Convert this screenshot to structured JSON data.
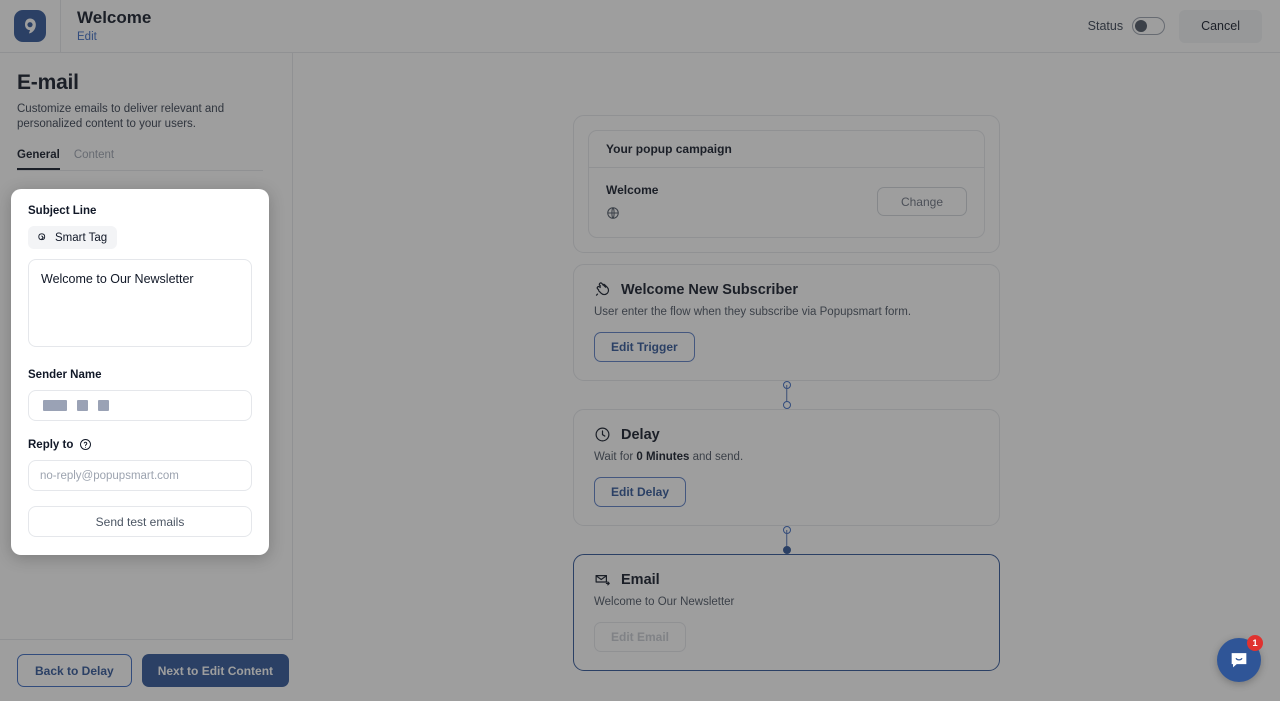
{
  "topbar": {
    "logo_icon": "popupsmart-logo-icon",
    "title": "Welcome",
    "edit_link": "Edit",
    "status_label": "Status",
    "status_on": false,
    "cancel_label": "Cancel"
  },
  "left_panel": {
    "heading": "E-mail",
    "description": "Customize emails to deliver relevant and personalized content to your users.",
    "tabs": [
      {
        "label": "General",
        "active": true
      },
      {
        "label": "Content",
        "active": false
      }
    ],
    "form": {
      "subject_label": "Subject Line",
      "smart_tag_label": "Smart Tag",
      "smart_tag_icon": "code-braces-icon",
      "subject_value": "Welcome to Our Newsletter",
      "sender_label": "Sender Name",
      "sender_value_redacted": true,
      "reply_label": "Reply to",
      "reply_help_icon": "help-circle-icon",
      "reply_placeholder": "no-reply@popupsmart.com",
      "reply_value": "",
      "send_test_label": "Send test emails"
    },
    "footer": {
      "back_label": "Back to Delay",
      "next_label": "Next to Edit Content"
    }
  },
  "flow": {
    "campaign_card": {
      "header": "Your popup campaign",
      "name": "Welcome",
      "type_icon": "globe-icon",
      "change_label": "Change"
    },
    "nodes": [
      {
        "icon": "wave-hand-icon",
        "title": "Welcome New Subscriber",
        "subtitle": "User enter the flow when they subscribe via Popupsmart form.",
        "button_label": "Edit Trigger",
        "button_disabled": false,
        "selected": false
      },
      {
        "icon": "clock-icon",
        "title": "Delay",
        "subtitle_prefix": "Wait for ",
        "subtitle_strong": "0 Minutes",
        "subtitle_suffix": " and send.",
        "button_label": "Edit Delay",
        "button_disabled": false,
        "selected": false
      },
      {
        "icon": "mail-icon",
        "title": "Email",
        "subtitle": "Welcome to Our Newsletter",
        "button_label": "Edit Email",
        "button_disabled": true,
        "selected": true
      }
    ]
  },
  "chat_widget": {
    "icon": "chat-bubble-icon",
    "badge": "1"
  },
  "colors": {
    "brand_blue": "#2f5597",
    "link_blue": "#3b6bc4",
    "badge_red": "#e0322f",
    "border": "#e5e7eb"
  }
}
